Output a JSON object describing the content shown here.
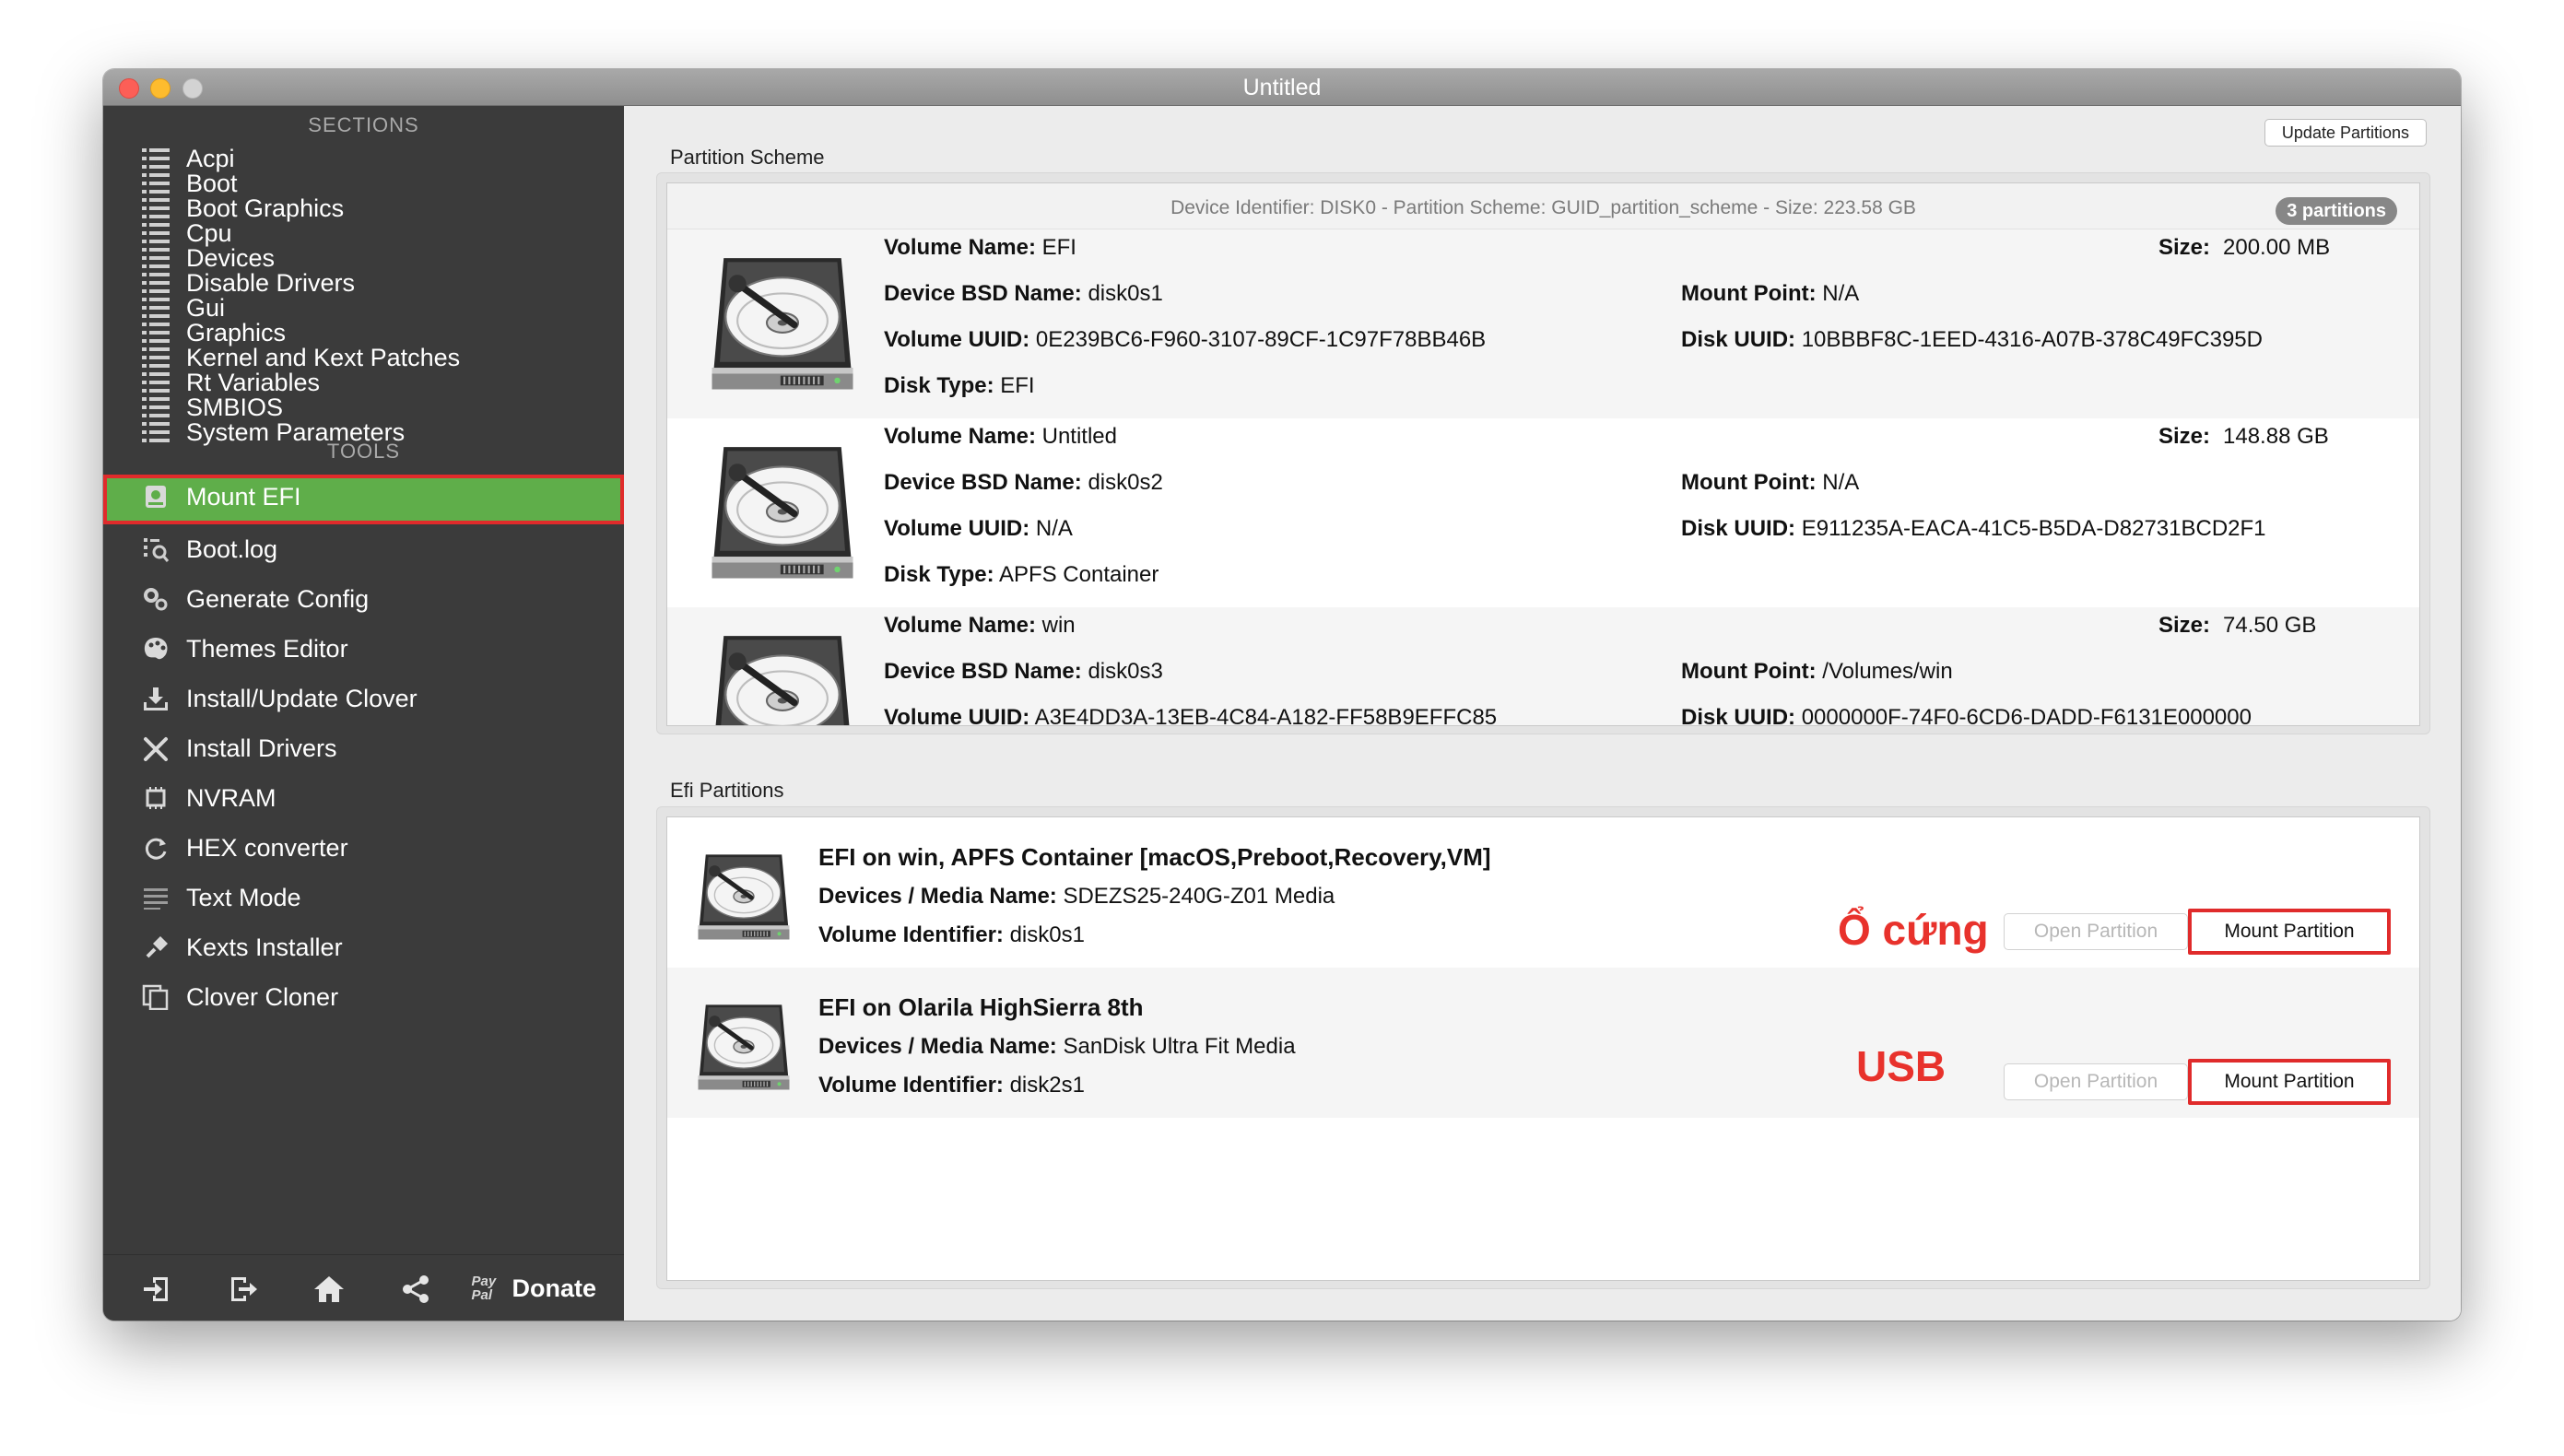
{
  "window": {
    "title": "Untitled"
  },
  "sidebar": {
    "sections_header": "SECTIONS",
    "sections": [
      {
        "label": "Acpi"
      },
      {
        "label": "Boot"
      },
      {
        "label": "Boot Graphics"
      },
      {
        "label": "Cpu"
      },
      {
        "label": "Devices"
      },
      {
        "label": "Disable Drivers"
      },
      {
        "label": "Gui"
      },
      {
        "label": "Graphics"
      },
      {
        "label": "Kernel and Kext Patches"
      },
      {
        "label": "Rt Variables"
      },
      {
        "label": "SMBIOS"
      },
      {
        "label": "System Parameters"
      }
    ],
    "tools_header": "TOOLS",
    "tools": [
      {
        "label": "Mount EFI",
        "icon": "disk-icon",
        "active": true
      },
      {
        "label": "Boot.log",
        "icon": "log-search-icon"
      },
      {
        "label": "Generate Config",
        "icon": "gears-icon"
      },
      {
        "label": "Themes Editor",
        "icon": "palette-icon"
      },
      {
        "label": "Install/Update Clover",
        "icon": "download-icon"
      },
      {
        "label": "Install Drivers",
        "icon": "tools-icon"
      },
      {
        "label": "NVRAM",
        "icon": "chip-icon"
      },
      {
        "label": "HEX converter",
        "icon": "refresh-icon"
      },
      {
        "label": "Text Mode",
        "icon": "text-lines-icon"
      },
      {
        "label": "Kexts Installer",
        "icon": "plug-icon"
      },
      {
        "label": "Clover Cloner",
        "icon": "copy-icon"
      }
    ],
    "bottom": {
      "buttons": [
        "import-icon",
        "export-icon",
        "home-icon",
        "share-icon"
      ],
      "paypal": "Pay Pal",
      "donate": "Donate"
    }
  },
  "partition_scheme": {
    "label": "Partition Scheme",
    "update_button": "Update Partitions",
    "header": "Device Identifier: DISK0 - Partition Scheme: GUID_partition_scheme - Size: 223.58 GB",
    "badge": "3 partitions",
    "keys": {
      "volume_name": "Volume Name:",
      "bsd_name": "Device BSD Name:",
      "volume_uuid": "Volume UUID:",
      "disk_type": "Disk Type:",
      "size": "Size:",
      "mount_point": "Mount Point:",
      "disk_uuid": "Disk UUID:"
    },
    "partitions": [
      {
        "volume_name": "EFI",
        "bsd_name": "disk0s1",
        "volume_uuid": "0E239BC6-F960-3107-89CF-1C97F78BB46B",
        "disk_type": "EFI",
        "size": "200.00 MB",
        "mount_point": "N/A",
        "disk_uuid": "10BBBF8C-1EED-4316-A07B-378C49FC395D"
      },
      {
        "volume_name": "Untitled",
        "bsd_name": "disk0s2",
        "volume_uuid": "N/A",
        "disk_type": "APFS Container",
        "size": "148.88 GB",
        "mount_point": "N/A",
        "disk_uuid": "E911235A-EACA-41C5-B5DA-D82731BCD2F1"
      },
      {
        "volume_name": "win",
        "bsd_name": "disk0s3",
        "volume_uuid": "A3E4DD3A-13EB-4C84-A182-FF58B9EFFC85",
        "disk_type": "",
        "size": "74.50 GB",
        "mount_point": "/Volumes/win",
        "disk_uuid": "0000000F-74F0-6CD6-DADD-F6131E000000"
      }
    ]
  },
  "efi_partitions": {
    "label": "Efi Partitions",
    "keys": {
      "media_name": "Devices / Media Name:",
      "volume_identifier": "Volume Identifier:"
    },
    "items": [
      {
        "title": "EFI on win, APFS Container [macOS,Preboot,Recovery,VM]",
        "media_name": "SDEZS25-240G-Z01 Media",
        "volume_identifier": "disk0s1",
        "annotation": "Ổ cứng",
        "open_button": "Open Partition",
        "mount_button": "Mount Partition"
      },
      {
        "title": "EFI on Olarila HighSierra 8th",
        "media_name": "SanDisk Ultra Fit Media",
        "volume_identifier": "disk2s1",
        "annotation": "USB",
        "open_button": "Open Partition",
        "mount_button": "Mount Partition"
      }
    ]
  }
}
